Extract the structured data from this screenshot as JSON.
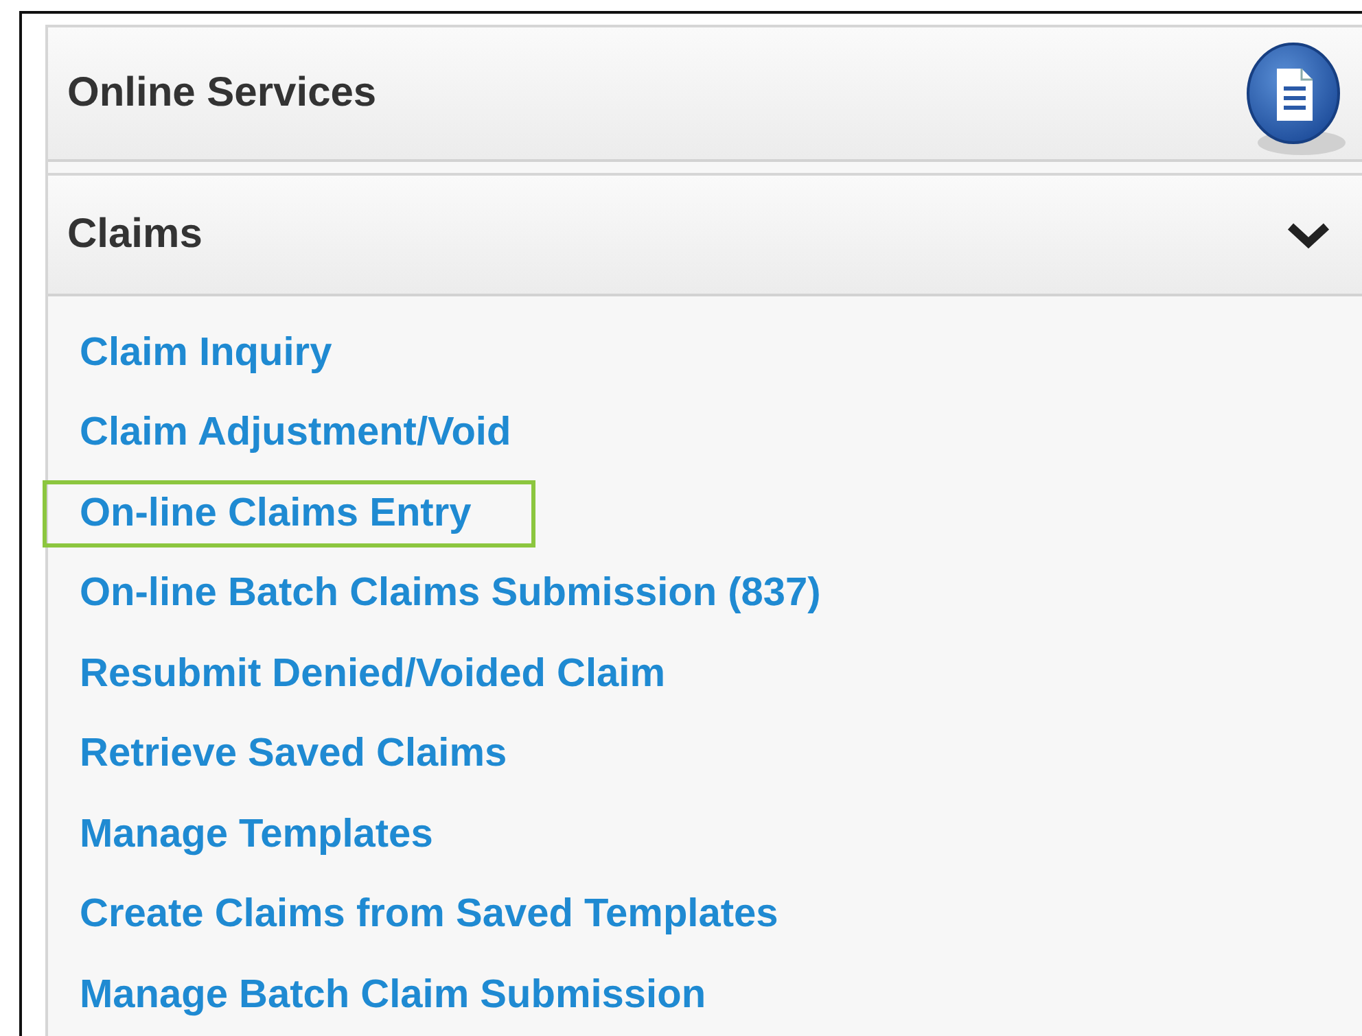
{
  "panel": {
    "title": "Online Services"
  },
  "section": {
    "title": "Claims",
    "expanded": true,
    "items": [
      {
        "label": "Claim Inquiry",
        "highlighted": false
      },
      {
        "label": "Claim Adjustment/Void",
        "highlighted": false
      },
      {
        "label": "On-line Claims Entry",
        "highlighted": true
      },
      {
        "label": "On-line Batch Claims Submission (837)",
        "highlighted": false
      },
      {
        "label": "Resubmit Denied/Voided Claim",
        "highlighted": false
      },
      {
        "label": "Retrieve Saved Claims",
        "highlighted": false
      },
      {
        "label": "Manage Templates",
        "highlighted": false
      },
      {
        "label": "Create Claims from Saved Templates",
        "highlighted": false
      },
      {
        "label": "Manage Batch Claim Submission",
        "highlighted": false
      }
    ]
  }
}
